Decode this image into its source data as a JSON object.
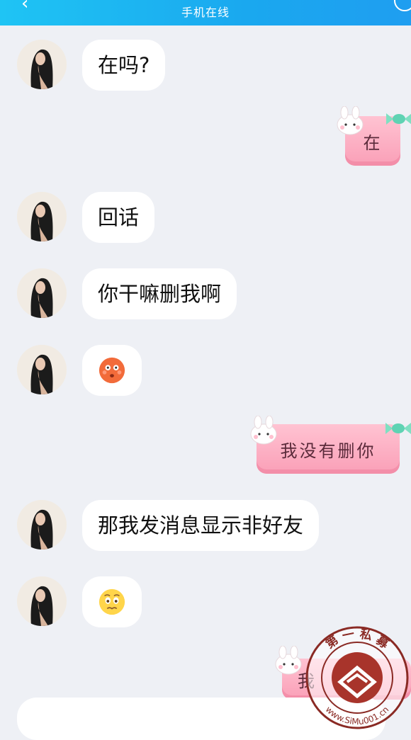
{
  "header": {
    "status": "手机在线",
    "back_icon": "chevron-left-icon",
    "more_icon": "circle-icon",
    "gradient_colors": [
      "#1fc4f4",
      "#1f9ef0"
    ]
  },
  "messages": [
    {
      "side": "in",
      "type": "text",
      "text": "在吗?"
    },
    {
      "side": "out",
      "type": "text",
      "text": "在"
    },
    {
      "side": "in",
      "type": "text",
      "text": "回话"
    },
    {
      "side": "in",
      "type": "text",
      "text": "你干嘛删我啊"
    },
    {
      "side": "in",
      "type": "emoji",
      "emoji": "flushed-face-emoji"
    },
    {
      "side": "out",
      "type": "text",
      "text": "我没有删你"
    },
    {
      "side": "in",
      "type": "text",
      "text": "那我发消息显示非好友"
    },
    {
      "side": "in",
      "type": "emoji",
      "emoji": "pleading-face-emoji"
    },
    {
      "side": "out",
      "type": "text",
      "text": "我"
    }
  ],
  "colors": {
    "background": "#eef0f5",
    "incoming_bubble": "#ffffff",
    "outgoing_bubble": "#fa9fb7"
  },
  "watermark": {
    "top_text": "第 一 私 募",
    "url_text": "www.SiMu001.cn"
  }
}
